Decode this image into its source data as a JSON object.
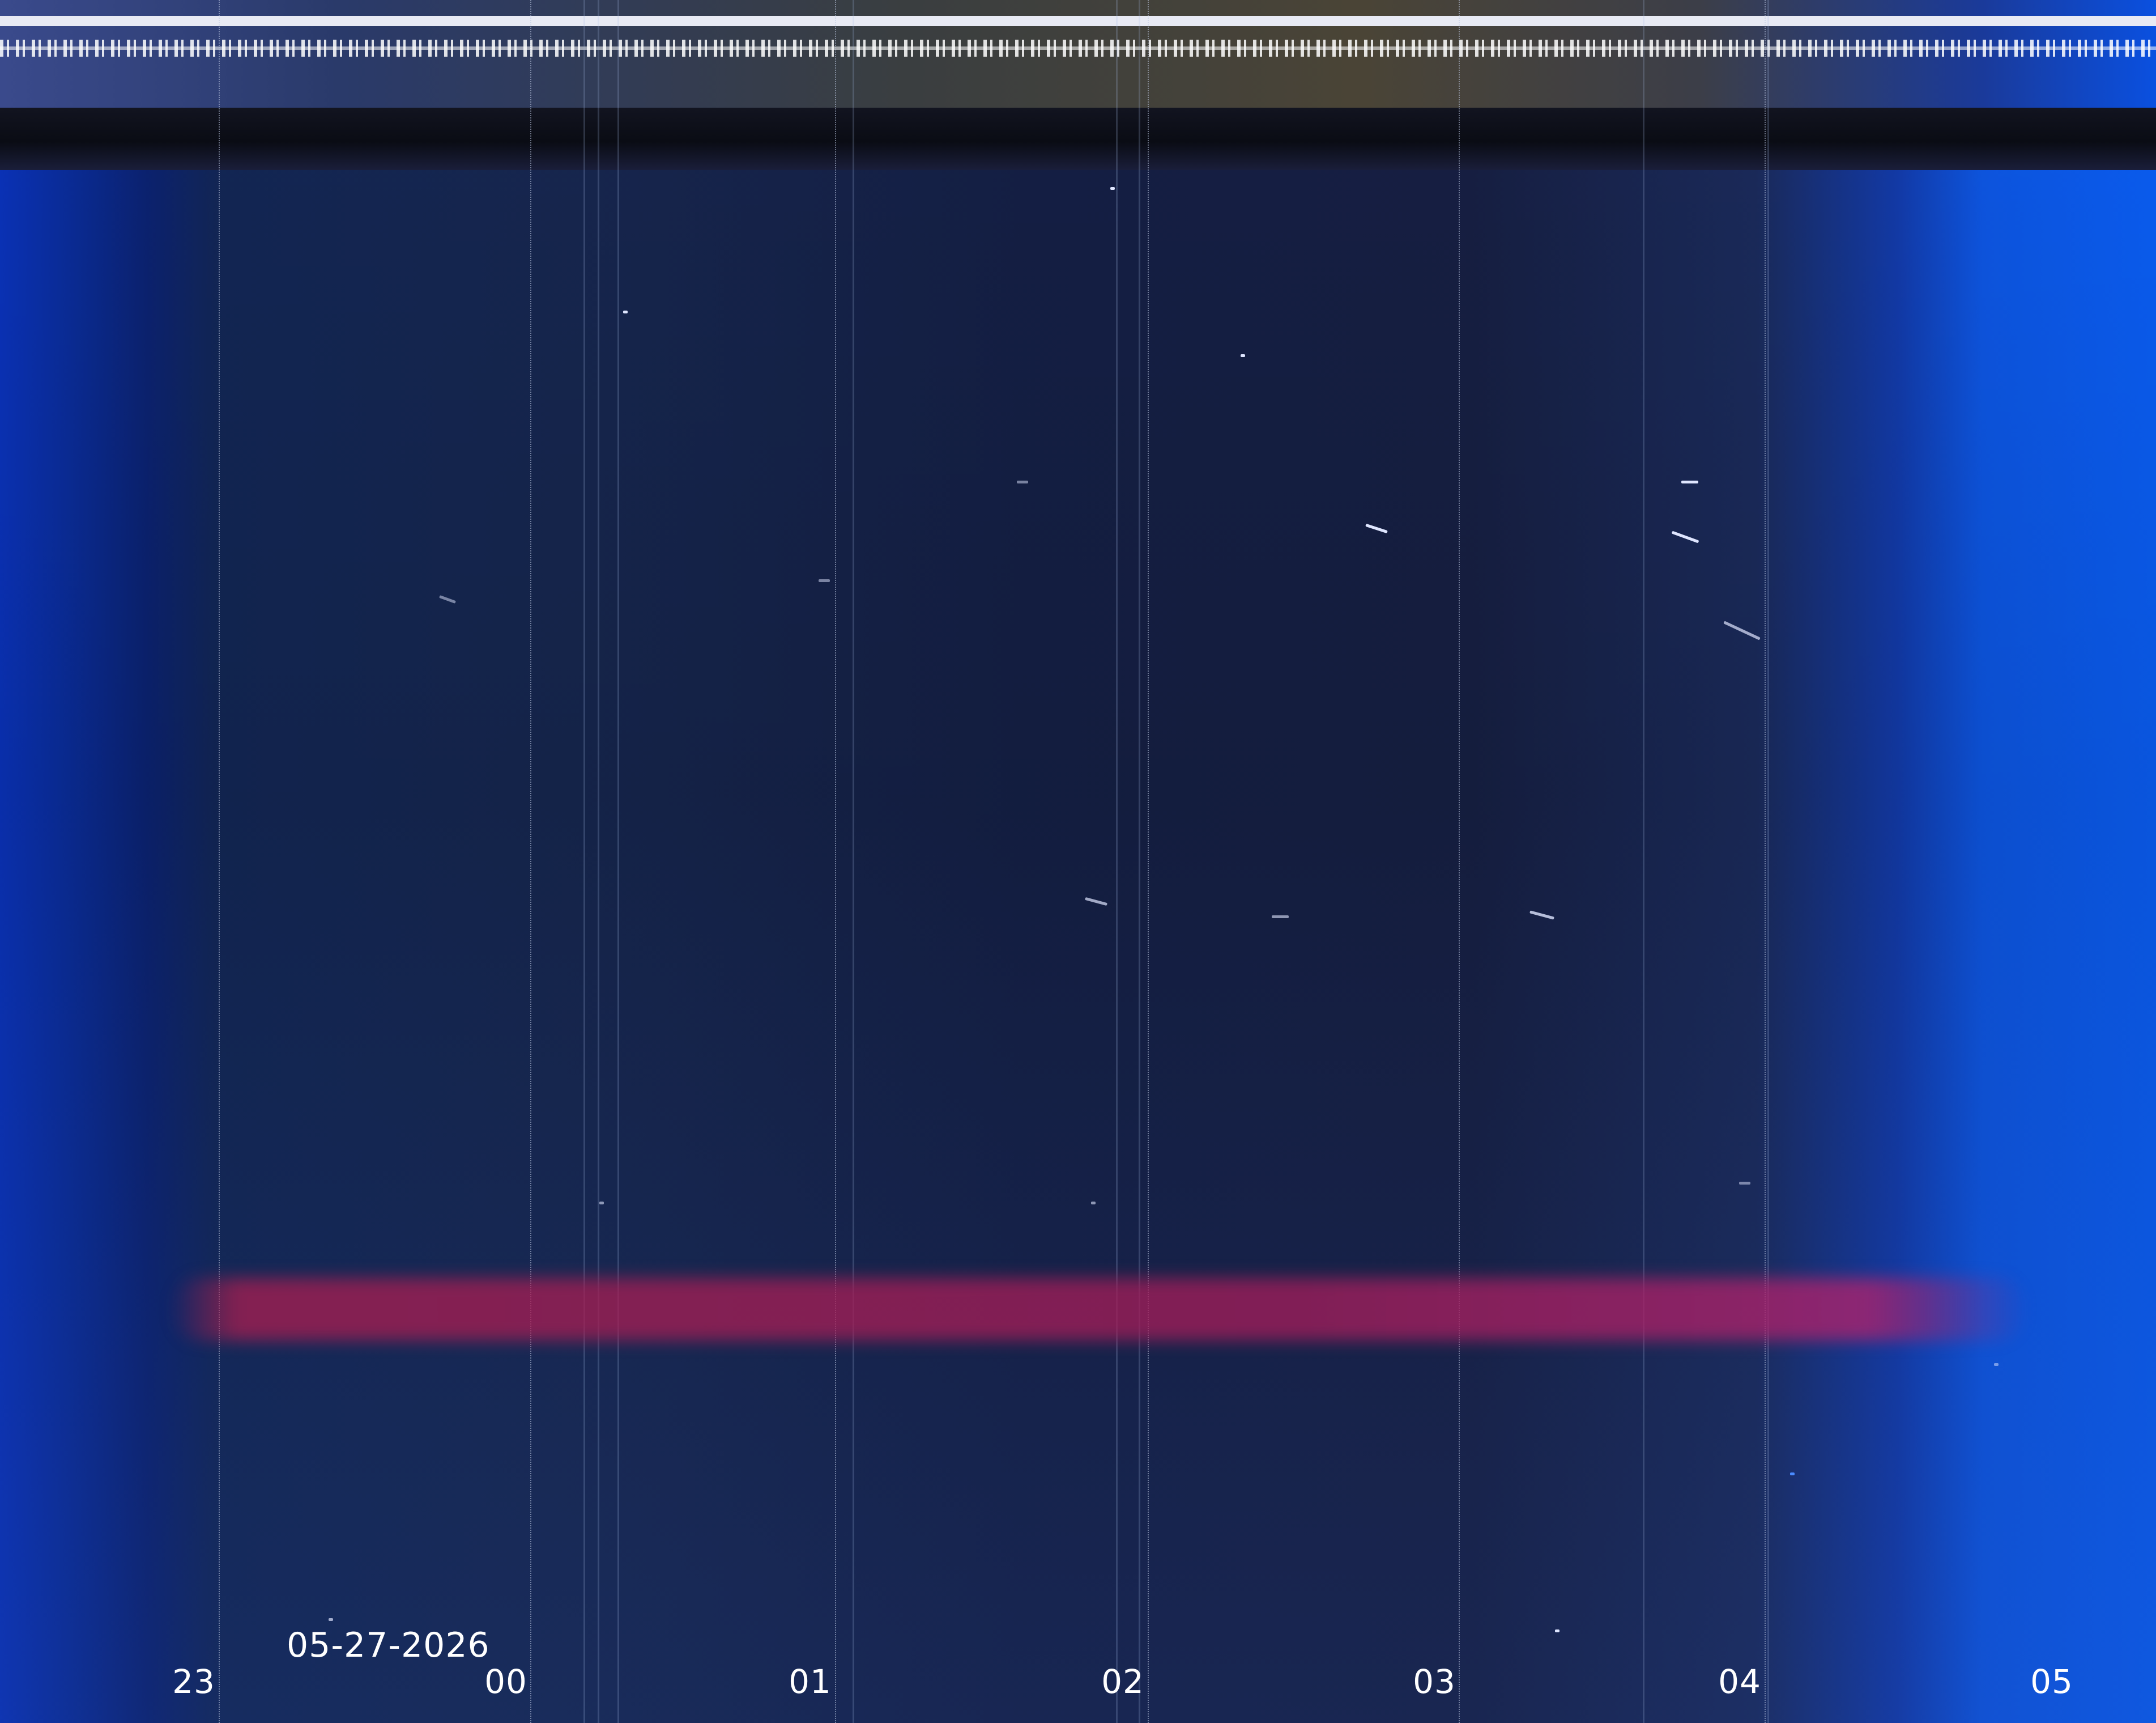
{
  "keogram": {
    "date_label": "05-27-2026",
    "hour_ticks": [
      "23",
      "00",
      "01",
      "02",
      "03",
      "04",
      "05"
    ]
  },
  "colors": {
    "sky_dark": "#16264e",
    "edge_blue": "#0a5cf0",
    "aurora_red": "#b01e50",
    "header_stripe": "#e8eaf4",
    "label_text": "#ffffff"
  }
}
